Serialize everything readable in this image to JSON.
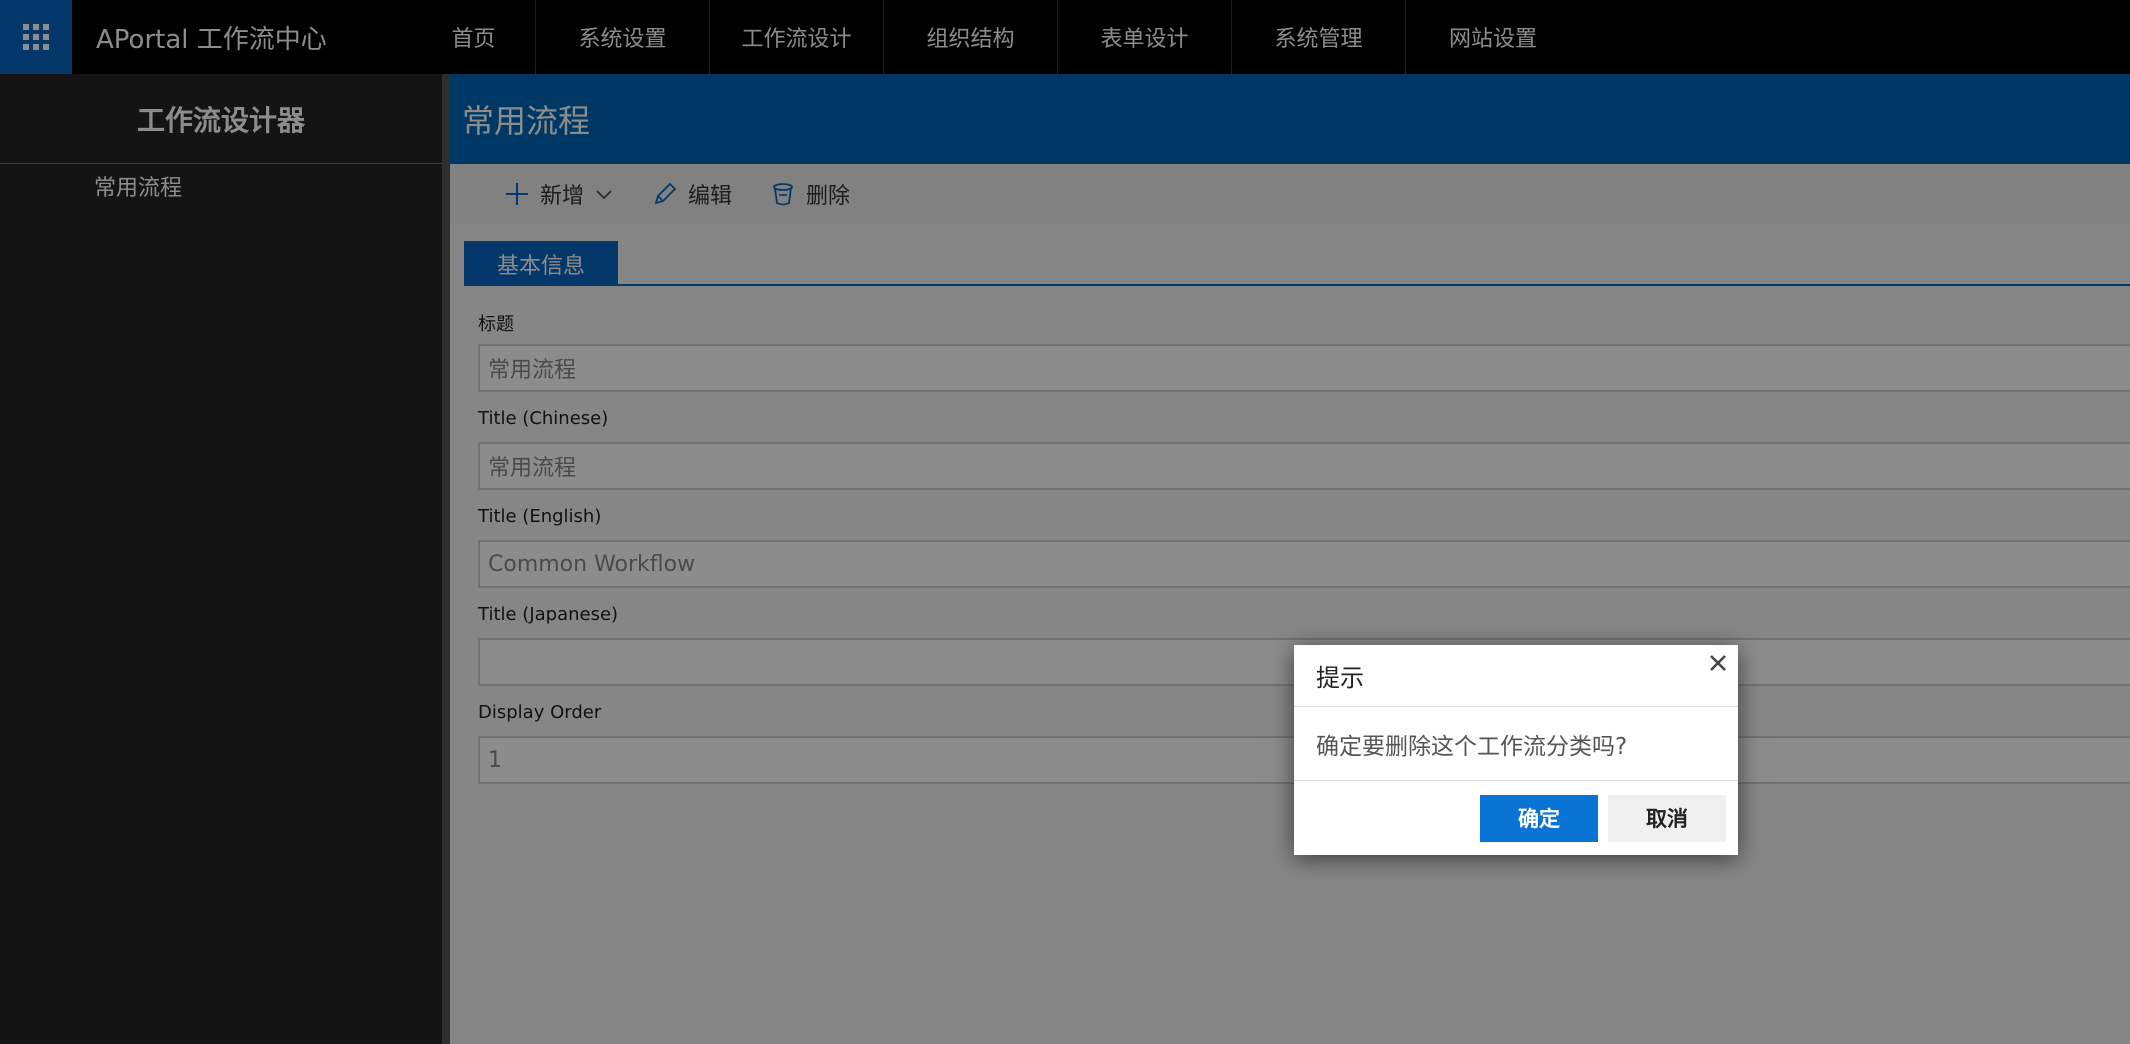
{
  "colors": {
    "accent": "#0a67c2",
    "header_blue": "#0067b8",
    "topbar_bg": "#000000",
    "sidebar_bg": "#252525",
    "overlay": "rgba(0,0,0,0.45)"
  },
  "topbar": {
    "app_launcher_icon": "waffle-grid-icon",
    "brand": "APortal 工作流中心",
    "nav": [
      {
        "label": "首页"
      },
      {
        "label": "系统设置"
      },
      {
        "label": "工作流设计"
      },
      {
        "label": "组织结构"
      },
      {
        "label": "表单设计"
      },
      {
        "label": "系统管理"
      },
      {
        "label": "网站设置"
      }
    ]
  },
  "sidebar": {
    "title": "工作流设计器",
    "items": [
      {
        "label": "常用流程"
      }
    ]
  },
  "main": {
    "title": "常用流程",
    "toolbar": {
      "add": {
        "label": "新增",
        "icon": "plus-icon",
        "dropdown_icon": "chevron-down-icon"
      },
      "edit": {
        "label": "编辑",
        "icon": "pencil-icon"
      },
      "delete": {
        "label": "删除",
        "icon": "trash-icon"
      }
    },
    "tabs": [
      {
        "label": "基本信息",
        "active": true
      }
    ],
    "form": {
      "fields": [
        {
          "label": "标题",
          "value": "常用流程"
        },
        {
          "label": "Title (Chinese)",
          "value": "常用流程"
        },
        {
          "label": "Title (English)",
          "value": "Common Workflow"
        },
        {
          "label": "Title (Japanese)",
          "value": ""
        },
        {
          "label": "Display Order",
          "value": "1"
        }
      ]
    }
  },
  "dialog": {
    "title": "提示",
    "message": "确定要删除这个工作流分类吗?",
    "confirm_label": "确定",
    "cancel_label": "取消",
    "close_icon": "close-icon"
  }
}
